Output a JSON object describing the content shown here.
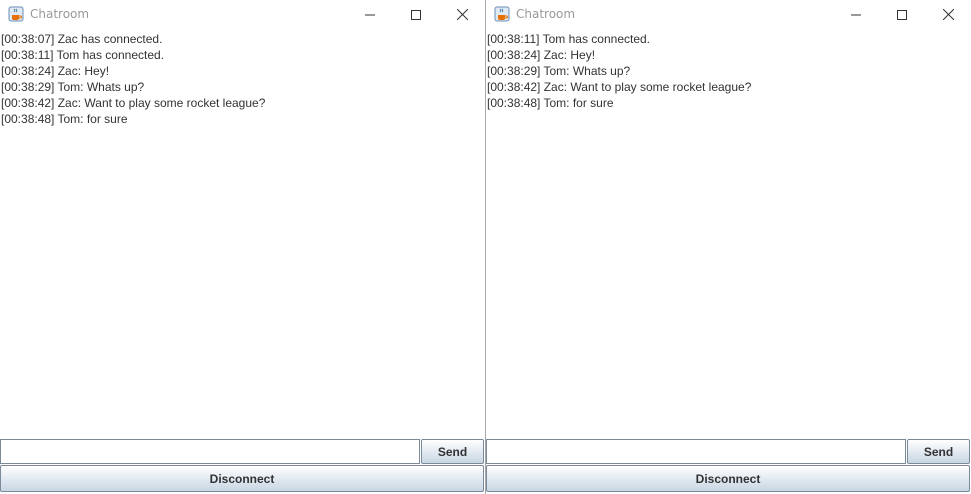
{
  "windows": [
    {
      "title": "Chatroom",
      "messages": [
        "[00:38:07] Zac has connected.",
        "[00:38:11] Tom has connected.",
        "[00:38:24] Zac: Hey!",
        "[00:38:29] Tom: Whats up?",
        "[00:38:42] Zac: Want to play some rocket league?",
        "[00:38:48] Tom: for sure"
      ],
      "input_value": "",
      "send_label": "Send",
      "disconnect_label": "Disconnect"
    },
    {
      "title": "Chatroom",
      "messages": [
        "[00:38:11] Tom has connected.",
        "[00:38:24] Zac: Hey!",
        "[00:38:29] Tom: Whats up?",
        "[00:38:42] Zac: Want to play some rocket league?",
        "[00:38:48] Tom: for sure"
      ],
      "input_value": "",
      "send_label": "Send",
      "disconnect_label": "Disconnect"
    }
  ],
  "icons": {
    "app": "java-coffee-cup-icon",
    "minimize": "minimize-icon",
    "maximize": "maximize-icon",
    "close": "close-icon"
  },
  "colors": {
    "title_text": "#999999",
    "button_border": "#7a8a99",
    "button_gradient_bottom": "#c9d6e3"
  }
}
